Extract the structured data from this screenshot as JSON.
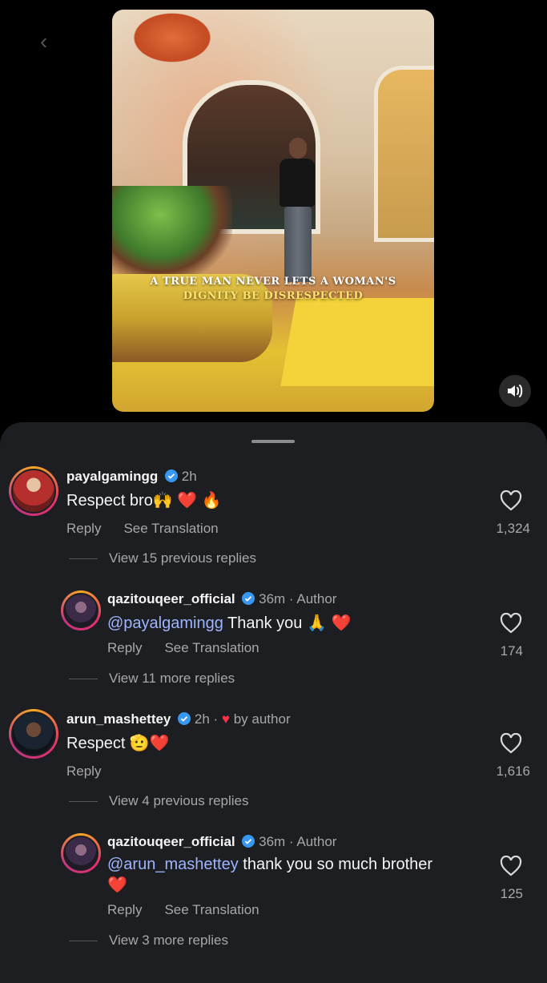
{
  "video": {
    "caption_line1": "A TRUE MAN NEVER LETS A WOMAN'S",
    "caption_line2": "DIGNITY BE DISRESPECTED"
  },
  "icons": {
    "back": "chevron-left-icon",
    "volume": "speaker-icon",
    "verified": "verified-badge-icon",
    "like": "heart-outline-icon"
  },
  "colors": {
    "sheet_bg": "#1c1e22",
    "mention": "#9fb4ff",
    "verified": "#3897f0",
    "heart": "#ff3040"
  },
  "comments": [
    {
      "username": "payalgamingg",
      "time": "2h",
      "text": "Respect bro🙌 ❤️ 🔥",
      "reply_label": "Reply",
      "translate_label": "See Translation",
      "likes": "1,324",
      "view_replies": "View 15 previous replies"
    },
    {
      "username": "qazitouqeer_official",
      "time": "36m · Author",
      "mention": "@payalgamingg",
      "text": " Thank you 🙏 ❤️",
      "reply_label": "Reply",
      "translate_label": "See Translation",
      "likes": "174",
      "view_replies": "View 11 more replies"
    },
    {
      "username": "arun_mashettey",
      "time": "2h · ",
      "liked_by": "by author",
      "text": "Respect 🫡❤️",
      "reply_label": "Reply",
      "likes": "1,616",
      "view_replies": "View 4 previous replies"
    },
    {
      "username": "qazitouqeer_official",
      "time": "36m · Author",
      "mention": "@arun_mashettey",
      "text": " thank you so much brother",
      "text_line2": "❤️",
      "reply_label": "Reply",
      "translate_label": "See Translation",
      "likes": "125",
      "view_replies": "View 3 more replies"
    }
  ]
}
